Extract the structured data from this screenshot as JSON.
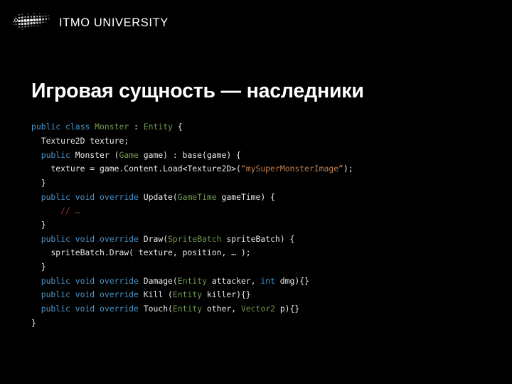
{
  "slide": {
    "background_color": "#000000",
    "brand": {
      "logo_icon": "itmo-dot-matrix-logo",
      "name": "ITMO UNIVERSITY",
      "name_color": "#ffffff"
    },
    "title": "Игровая сущность — наследники",
    "title_color": "#ffffff"
  },
  "code": {
    "language": "csharp",
    "colors": {
      "keyword": "#4a95c9",
      "type": "#6f9850",
      "string": "#bf7f4f",
      "comment": "#9b3b3b",
      "plain": "#eaeaea"
    },
    "lines": [
      {
        "indent": 0,
        "tokens": [
          {
            "t": "public",
            "c": "kw"
          },
          {
            "t": " ",
            "c": "plain"
          },
          {
            "t": "class",
            "c": "kw"
          },
          {
            "t": " ",
            "c": "plain"
          },
          {
            "t": "Monster",
            "c": "type"
          },
          {
            "t": " : ",
            "c": "plain"
          },
          {
            "t": "Entity",
            "c": "type"
          },
          {
            "t": " {",
            "c": "plain"
          }
        ]
      },
      {
        "indent": 1,
        "tokens": [
          {
            "t": "Texture2D texture;",
            "c": "plain"
          }
        ]
      },
      {
        "indent": 1,
        "tokens": [
          {
            "t": "public",
            "c": "kw"
          },
          {
            "t": " Monster (",
            "c": "plain"
          },
          {
            "t": "Game",
            "c": "type"
          },
          {
            "t": " game) : base(game) {",
            "c": "plain"
          }
        ]
      },
      {
        "indent": 2,
        "tokens": [
          {
            "t": "texture = game.Content.Load<Texture2D>(",
            "c": "plain"
          },
          {
            "t": "“mySuperMonsterImage”",
            "c": "str"
          },
          {
            "t": ");",
            "c": "plain"
          }
        ]
      },
      {
        "indent": 1,
        "tokens": [
          {
            "t": "}",
            "c": "plain"
          }
        ]
      },
      {
        "indent": 1,
        "tokens": [
          {
            "t": "public",
            "c": "kw"
          },
          {
            "t": " ",
            "c": "plain"
          },
          {
            "t": "void",
            "c": "kw"
          },
          {
            "t": " ",
            "c": "plain"
          },
          {
            "t": "override",
            "c": "kw"
          },
          {
            "t": " Update(",
            "c": "plain"
          },
          {
            "t": "GameTime",
            "c": "type"
          },
          {
            "t": " gameTime) {",
            "c": "plain"
          }
        ]
      },
      {
        "indent": 3,
        "tokens": [
          {
            "t": "// …",
            "c": "cmt"
          }
        ]
      },
      {
        "indent": 1,
        "tokens": [
          {
            "t": "}",
            "c": "plain"
          }
        ]
      },
      {
        "indent": 1,
        "tokens": [
          {
            "t": "public",
            "c": "kw"
          },
          {
            "t": " ",
            "c": "plain"
          },
          {
            "t": "void",
            "c": "kw"
          },
          {
            "t": " ",
            "c": "plain"
          },
          {
            "t": "override",
            "c": "kw"
          },
          {
            "t": " Draw(",
            "c": "plain"
          },
          {
            "t": "SpriteBatch",
            "c": "type"
          },
          {
            "t": " spriteBatch) {",
            "c": "plain"
          }
        ]
      },
      {
        "indent": 2,
        "tokens": [
          {
            "t": "spriteBatch.Draw( texture, position, … );",
            "c": "plain"
          }
        ]
      },
      {
        "indent": 1,
        "tokens": [
          {
            "t": "}",
            "c": "plain"
          }
        ]
      },
      {
        "indent": 1,
        "tokens": [
          {
            "t": "public",
            "c": "kw"
          },
          {
            "t": " ",
            "c": "plain"
          },
          {
            "t": "void",
            "c": "kw"
          },
          {
            "t": " ",
            "c": "plain"
          },
          {
            "t": "override",
            "c": "kw"
          },
          {
            "t": " Damage(",
            "c": "plain"
          },
          {
            "t": "Entity",
            "c": "type"
          },
          {
            "t": " attacker, ",
            "c": "plain"
          },
          {
            "t": "int",
            "c": "kw"
          },
          {
            "t": " dmg){}",
            "c": "plain"
          }
        ]
      },
      {
        "indent": 1,
        "tokens": [
          {
            "t": "public",
            "c": "kw"
          },
          {
            "t": " ",
            "c": "plain"
          },
          {
            "t": "void",
            "c": "kw"
          },
          {
            "t": " ",
            "c": "plain"
          },
          {
            "t": "override",
            "c": "kw"
          },
          {
            "t": " Kill (",
            "c": "plain"
          },
          {
            "t": "Entity",
            "c": "type"
          },
          {
            "t": " killer){}",
            "c": "plain"
          }
        ]
      },
      {
        "indent": 1,
        "tokens": [
          {
            "t": "public",
            "c": "kw"
          },
          {
            "t": " ",
            "c": "plain"
          },
          {
            "t": "void",
            "c": "kw"
          },
          {
            "t": " ",
            "c": "plain"
          },
          {
            "t": "override",
            "c": "kw"
          },
          {
            "t": " Touch(",
            "c": "plain"
          },
          {
            "t": "Entity",
            "c": "type"
          },
          {
            "t": " other, ",
            "c": "plain"
          },
          {
            "t": "Vector2",
            "c": "type"
          },
          {
            "t": " p){}",
            "c": "plain"
          }
        ]
      },
      {
        "indent": 0,
        "tokens": [
          {
            "t": "}",
            "c": "plain"
          }
        ]
      }
    ]
  }
}
